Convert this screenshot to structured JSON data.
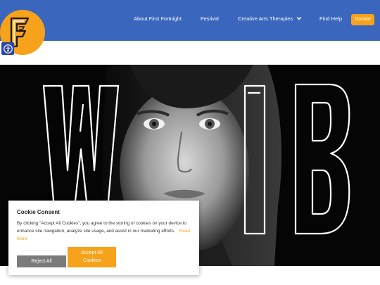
{
  "nav": {
    "items": [
      {
        "label": "About First Fortnight"
      },
      {
        "label": "Festival"
      },
      {
        "label": "Creative Arts Therapies"
      },
      {
        "label": "Find Help"
      }
    ],
    "donate_label": "Donate"
  },
  "icons": {
    "logo": "first-fortnight-logo",
    "accessibility": "accessibility-icon",
    "dropdown": "chevron-down-icon"
  },
  "colors": {
    "header": "#3a66be",
    "accent": "#f7a21b",
    "reject_button": "#7b7b7b"
  },
  "cookie": {
    "title": "Cookie Consent",
    "text": "By clicking \"Accept All Cookies\", you agree to the storing of cookies on your device to enhance site navigation, analyze site usage, and assist in our marketing efforts.",
    "read_more": "Read More",
    "reject_label": "Reject All",
    "accept_label_line1": "Accept All",
    "accept_label_line2": "Cookies"
  }
}
